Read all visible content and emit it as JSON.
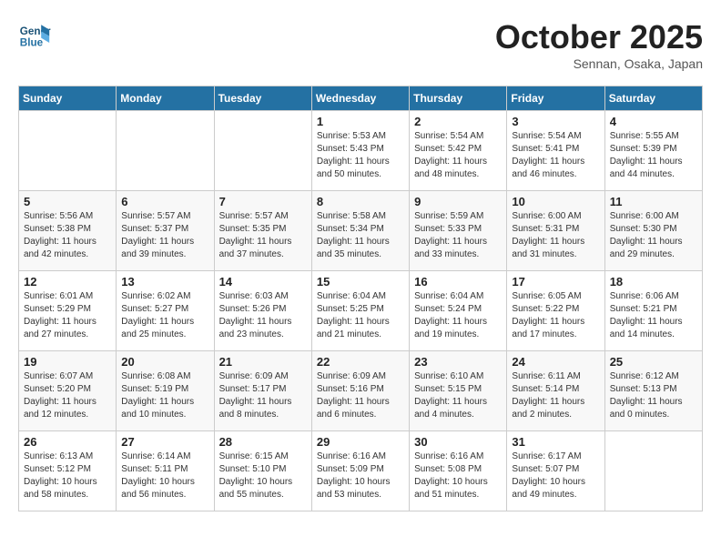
{
  "header": {
    "logo_line1": "General",
    "logo_line2": "Blue",
    "month": "October 2025",
    "location": "Sennan, Osaka, Japan"
  },
  "days_of_week": [
    "Sunday",
    "Monday",
    "Tuesday",
    "Wednesday",
    "Thursday",
    "Friday",
    "Saturday"
  ],
  "weeks": [
    [
      {
        "day": "",
        "info": ""
      },
      {
        "day": "",
        "info": ""
      },
      {
        "day": "",
        "info": ""
      },
      {
        "day": "1",
        "info": "Sunrise: 5:53 AM\nSunset: 5:43 PM\nDaylight: 11 hours\nand 50 minutes."
      },
      {
        "day": "2",
        "info": "Sunrise: 5:54 AM\nSunset: 5:42 PM\nDaylight: 11 hours\nand 48 minutes."
      },
      {
        "day": "3",
        "info": "Sunrise: 5:54 AM\nSunset: 5:41 PM\nDaylight: 11 hours\nand 46 minutes."
      },
      {
        "day": "4",
        "info": "Sunrise: 5:55 AM\nSunset: 5:39 PM\nDaylight: 11 hours\nand 44 minutes."
      }
    ],
    [
      {
        "day": "5",
        "info": "Sunrise: 5:56 AM\nSunset: 5:38 PM\nDaylight: 11 hours\nand 42 minutes."
      },
      {
        "day": "6",
        "info": "Sunrise: 5:57 AM\nSunset: 5:37 PM\nDaylight: 11 hours\nand 39 minutes."
      },
      {
        "day": "7",
        "info": "Sunrise: 5:57 AM\nSunset: 5:35 PM\nDaylight: 11 hours\nand 37 minutes."
      },
      {
        "day": "8",
        "info": "Sunrise: 5:58 AM\nSunset: 5:34 PM\nDaylight: 11 hours\nand 35 minutes."
      },
      {
        "day": "9",
        "info": "Sunrise: 5:59 AM\nSunset: 5:33 PM\nDaylight: 11 hours\nand 33 minutes."
      },
      {
        "day": "10",
        "info": "Sunrise: 6:00 AM\nSunset: 5:31 PM\nDaylight: 11 hours\nand 31 minutes."
      },
      {
        "day": "11",
        "info": "Sunrise: 6:00 AM\nSunset: 5:30 PM\nDaylight: 11 hours\nand 29 minutes."
      }
    ],
    [
      {
        "day": "12",
        "info": "Sunrise: 6:01 AM\nSunset: 5:29 PM\nDaylight: 11 hours\nand 27 minutes."
      },
      {
        "day": "13",
        "info": "Sunrise: 6:02 AM\nSunset: 5:27 PM\nDaylight: 11 hours\nand 25 minutes."
      },
      {
        "day": "14",
        "info": "Sunrise: 6:03 AM\nSunset: 5:26 PM\nDaylight: 11 hours\nand 23 minutes."
      },
      {
        "day": "15",
        "info": "Sunrise: 6:04 AM\nSunset: 5:25 PM\nDaylight: 11 hours\nand 21 minutes."
      },
      {
        "day": "16",
        "info": "Sunrise: 6:04 AM\nSunset: 5:24 PM\nDaylight: 11 hours\nand 19 minutes."
      },
      {
        "day": "17",
        "info": "Sunrise: 6:05 AM\nSunset: 5:22 PM\nDaylight: 11 hours\nand 17 minutes."
      },
      {
        "day": "18",
        "info": "Sunrise: 6:06 AM\nSunset: 5:21 PM\nDaylight: 11 hours\nand 14 minutes."
      }
    ],
    [
      {
        "day": "19",
        "info": "Sunrise: 6:07 AM\nSunset: 5:20 PM\nDaylight: 11 hours\nand 12 minutes."
      },
      {
        "day": "20",
        "info": "Sunrise: 6:08 AM\nSunset: 5:19 PM\nDaylight: 11 hours\nand 10 minutes."
      },
      {
        "day": "21",
        "info": "Sunrise: 6:09 AM\nSunset: 5:17 PM\nDaylight: 11 hours\nand 8 minutes."
      },
      {
        "day": "22",
        "info": "Sunrise: 6:09 AM\nSunset: 5:16 PM\nDaylight: 11 hours\nand 6 minutes."
      },
      {
        "day": "23",
        "info": "Sunrise: 6:10 AM\nSunset: 5:15 PM\nDaylight: 11 hours\nand 4 minutes."
      },
      {
        "day": "24",
        "info": "Sunrise: 6:11 AM\nSunset: 5:14 PM\nDaylight: 11 hours\nand 2 minutes."
      },
      {
        "day": "25",
        "info": "Sunrise: 6:12 AM\nSunset: 5:13 PM\nDaylight: 11 hours\nand 0 minutes."
      }
    ],
    [
      {
        "day": "26",
        "info": "Sunrise: 6:13 AM\nSunset: 5:12 PM\nDaylight: 10 hours\nand 58 minutes."
      },
      {
        "day": "27",
        "info": "Sunrise: 6:14 AM\nSunset: 5:11 PM\nDaylight: 10 hours\nand 56 minutes."
      },
      {
        "day": "28",
        "info": "Sunrise: 6:15 AM\nSunset: 5:10 PM\nDaylight: 10 hours\nand 55 minutes."
      },
      {
        "day": "29",
        "info": "Sunrise: 6:16 AM\nSunset: 5:09 PM\nDaylight: 10 hours\nand 53 minutes."
      },
      {
        "day": "30",
        "info": "Sunrise: 6:16 AM\nSunset: 5:08 PM\nDaylight: 10 hours\nand 51 minutes."
      },
      {
        "day": "31",
        "info": "Sunrise: 6:17 AM\nSunset: 5:07 PM\nDaylight: 10 hours\nand 49 minutes."
      },
      {
        "day": "",
        "info": ""
      }
    ]
  ]
}
